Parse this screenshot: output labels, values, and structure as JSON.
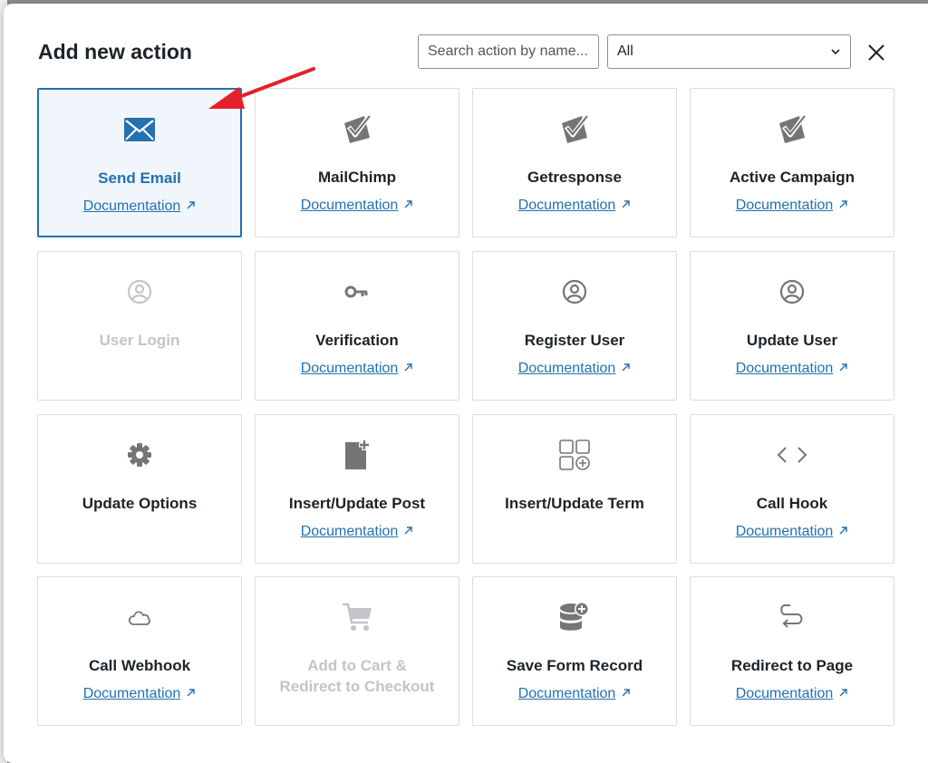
{
  "modal": {
    "title": "Add new action",
    "search": {
      "placeholder": "Search action by name...",
      "value": ""
    },
    "filter": {
      "selected": "All"
    }
  },
  "doc_label": "Documentation",
  "colors": {
    "accent": "#2271b1",
    "icon_gray": "#757575",
    "disabled": "#c3c4c7",
    "annotation_arrow": "#e5202b"
  },
  "actions": [
    {
      "label": "Send Email",
      "icon": "envelope-icon",
      "has_doc": true,
      "state": "selected"
    },
    {
      "label": "MailChimp",
      "icon": "check-envelope-icon",
      "has_doc": true,
      "state": "normal"
    },
    {
      "label": "Getresponse",
      "icon": "check-envelope-icon",
      "has_doc": true,
      "state": "normal"
    },
    {
      "label": "Active Campaign",
      "icon": "check-envelope-icon",
      "has_doc": true,
      "state": "normal"
    },
    {
      "label": "User Login",
      "icon": "user-circle-icon",
      "has_doc": false,
      "state": "disabled"
    },
    {
      "label": "Verification",
      "icon": "key-icon",
      "has_doc": true,
      "state": "normal"
    },
    {
      "label": "Register User",
      "icon": "user-circle-icon",
      "has_doc": true,
      "state": "normal"
    },
    {
      "label": "Update User",
      "icon": "user-circle-icon",
      "has_doc": true,
      "state": "normal"
    },
    {
      "label": "Update Options",
      "icon": "gear-icon",
      "has_doc": false,
      "state": "normal"
    },
    {
      "label": "Insert/Update Post",
      "icon": "document-plus-icon",
      "has_doc": true,
      "state": "normal"
    },
    {
      "label": "Insert/Update Term",
      "icon": "grid-plus-icon",
      "has_doc": false,
      "state": "normal"
    },
    {
      "label": "Call Hook",
      "icon": "code-brackets-icon",
      "has_doc": true,
      "state": "normal"
    },
    {
      "label": "Call Webhook",
      "icon": "cloud-icon",
      "has_doc": true,
      "state": "normal"
    },
    {
      "label_lines": [
        "Add to Cart &",
        "Redirect to Checkout"
      ],
      "icon": "cart-icon",
      "has_doc": false,
      "state": "disabled"
    },
    {
      "label": "Save Form Record",
      "icon": "database-plus-icon",
      "has_doc": true,
      "state": "normal"
    },
    {
      "label": "Redirect to Page",
      "icon": "redirect-icon",
      "has_doc": true,
      "state": "normal"
    }
  ]
}
